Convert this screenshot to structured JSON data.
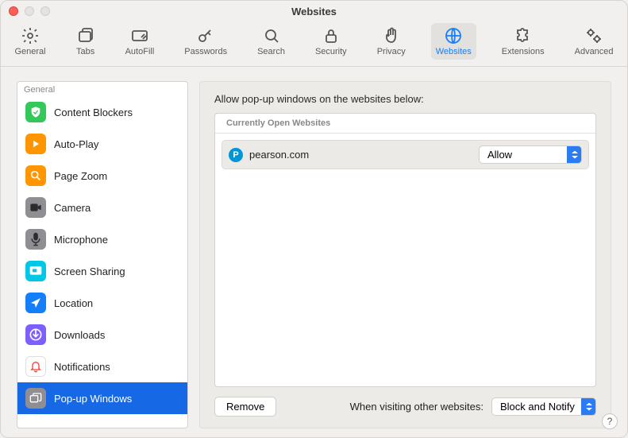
{
  "window": {
    "title": "Websites"
  },
  "toolbar": {
    "items": [
      {
        "label": "General",
        "icon": "gear-icon"
      },
      {
        "label": "Tabs",
        "icon": "tabs-icon"
      },
      {
        "label": "AutoFill",
        "icon": "autofill-icon"
      },
      {
        "label": "Passwords",
        "icon": "key-icon"
      },
      {
        "label": "Search",
        "icon": "search-icon"
      },
      {
        "label": "Security",
        "icon": "lock-icon"
      },
      {
        "label": "Privacy",
        "icon": "hand-icon"
      },
      {
        "label": "Websites",
        "icon": "globe-icon"
      },
      {
        "label": "Extensions",
        "icon": "puzzle-icon"
      },
      {
        "label": "Advanced",
        "icon": "gears-icon"
      }
    ],
    "active_index": 7
  },
  "sidebar": {
    "header": "General",
    "items": [
      {
        "label": "Content Blockers",
        "icon": "shield-check-icon",
        "bg": "#34c759"
      },
      {
        "label": "Auto-Play",
        "icon": "play-icon",
        "bg": "#ff9500"
      },
      {
        "label": "Page Zoom",
        "icon": "zoom-icon",
        "bg": "#ff9500"
      },
      {
        "label": "Camera",
        "icon": "camera-icon",
        "bg": "#8e8e93"
      },
      {
        "label": "Microphone",
        "icon": "mic-icon",
        "bg": "#8e8e93"
      },
      {
        "label": "Screen Sharing",
        "icon": "screenshare-icon",
        "bg": "#00c7e6"
      },
      {
        "label": "Location",
        "icon": "arrow-icon",
        "bg": "#157efb"
      },
      {
        "label": "Downloads",
        "icon": "download-icon",
        "bg": "#7d5fff"
      },
      {
        "label": "Notifications",
        "icon": "bell-icon",
        "bg": "#ffffff"
      },
      {
        "label": "Pop-up Windows",
        "icon": "windows-icon",
        "bg": "#8e8e93"
      }
    ],
    "selected_index": 9
  },
  "main": {
    "heading": "Allow pop-up windows on the websites below:",
    "table_header": "Currently Open Websites",
    "sites": [
      {
        "domain": "pearson.com",
        "favicon_letter": "P",
        "setting": "Allow"
      }
    ],
    "remove_label": "Remove",
    "default_label": "When visiting other websites:",
    "default_value": "Block and Notify"
  },
  "help": "?"
}
